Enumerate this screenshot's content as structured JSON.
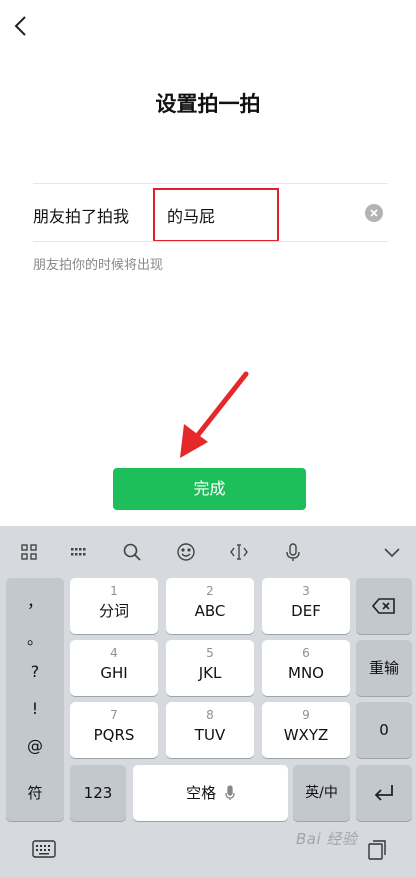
{
  "page": {
    "title": "设置拍一拍"
  },
  "pat_setting": {
    "label": "朋友拍了拍我",
    "value": "的马屁",
    "hint": "朋友拍你的时候将出现"
  },
  "done_label": "完成",
  "keyboard": {
    "toolbar": [
      "grid-icon",
      "keyboard-layout-icon",
      "search-icon",
      "emoji-icon",
      "cursor-icon",
      "microphone-icon",
      "chevron-down-icon"
    ],
    "symbols": [
      "，",
      "。",
      "?",
      "!",
      "@"
    ],
    "keys": [
      {
        "num": "1",
        "label": "分词"
      },
      {
        "num": "2",
        "label": "ABC"
      },
      {
        "num": "3",
        "label": "DEF"
      },
      {
        "num": "4",
        "label": "GHI"
      },
      {
        "num": "5",
        "label": "JKL"
      },
      {
        "num": "6",
        "label": "MNO"
      },
      {
        "num": "7",
        "label": "PQRS"
      },
      {
        "num": "8",
        "label": "TUV"
      },
      {
        "num": "9",
        "label": "WXYZ"
      }
    ],
    "reinput": "重输",
    "zero": "0",
    "fu": "符",
    "num123": "123",
    "space": "空格",
    "lang": "英/中"
  },
  "watermark": "Bai 经验",
  "colors": {
    "accent_green": "#1dbf5b",
    "highlight_red": "#e0202a",
    "arrow_red": "#e5282a"
  }
}
